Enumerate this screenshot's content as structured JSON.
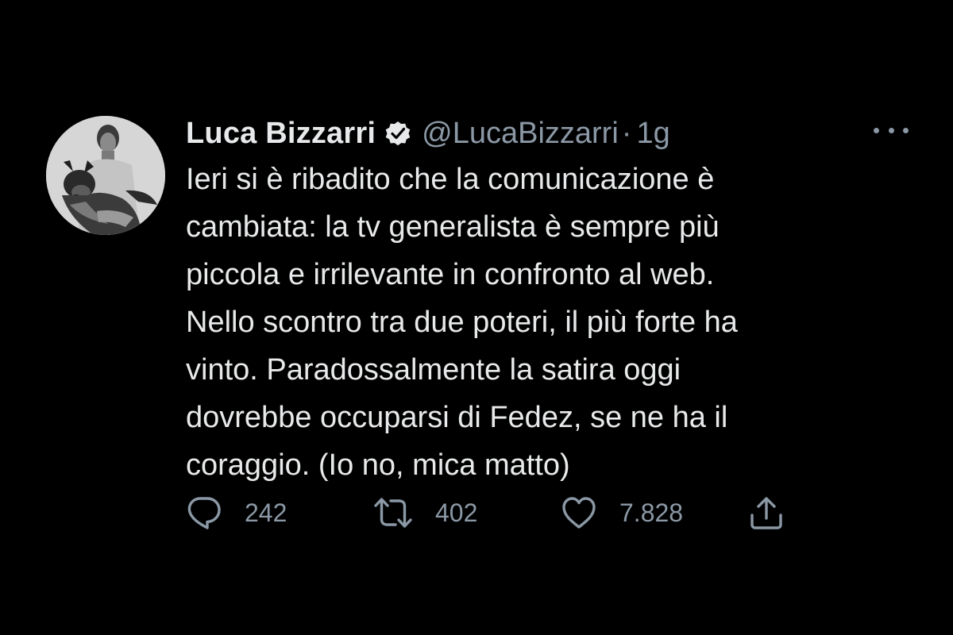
{
  "tweet": {
    "author": {
      "name": "Luca Bizzarri",
      "handle": "@LucaBizzarri",
      "verified": true,
      "avatar_icon": "profile-photo-man-with-dog"
    },
    "separator": "·",
    "timestamp": "1g",
    "text_lines": [
      "Ieri si è ribadito che la comunicazione è",
      "cambiata: la tv generalista è sempre più",
      "piccola e irrilevante in confronto al web.",
      "Nello scontro tra due poteri, il più forte ha",
      "vinto. Paradossalmente la satira oggi",
      "dovrebbe occuparsi di Fedez, se ne ha il",
      "coraggio. (Io no, mica matto)"
    ],
    "actions": {
      "reply": {
        "icon": "reply-icon",
        "count": "242"
      },
      "retweet": {
        "icon": "retweet-icon",
        "count": "402"
      },
      "like": {
        "icon": "heart-icon",
        "count": "7.828"
      },
      "share": {
        "icon": "share-icon"
      }
    },
    "more_icon": "more-options-icon"
  },
  "colors": {
    "background": "#000000",
    "primary_text": "#e7e9ea",
    "secondary_text": "#8b98a5",
    "verified_badge": "#e7e9ea"
  }
}
